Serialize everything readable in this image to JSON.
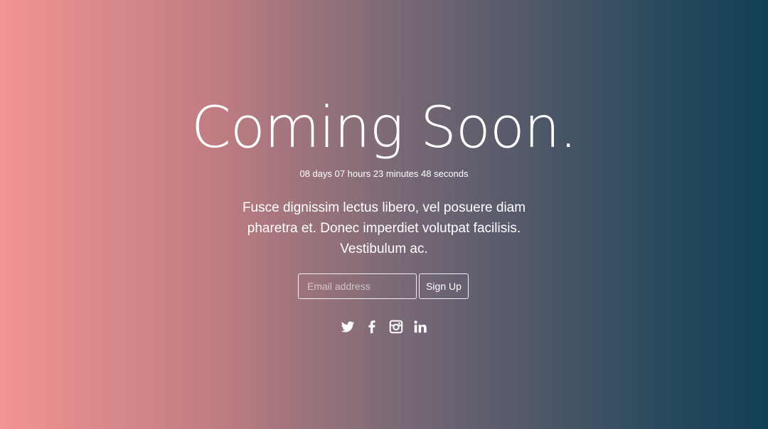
{
  "page": {
    "headline": "Coming Soon.",
    "countdown": "08 days 07 hours 23 minutes 48 seconds",
    "tagline": "Fusce dignissim lectus libero, vel posuere diam pharetra et. Donec imperdiet volutpat facilisis. Vestibulum ac."
  },
  "signup": {
    "email_placeholder": "Email address",
    "email_value": "",
    "button_label": "Sign Up"
  },
  "social": {
    "icons": [
      "twitter-icon",
      "facebook-icon",
      "instagram-icon",
      "linkedin-icon"
    ]
  },
  "colors": {
    "gradient_left": "#f29492",
    "gradient_right": "#113f54",
    "text": "#ffffff"
  }
}
